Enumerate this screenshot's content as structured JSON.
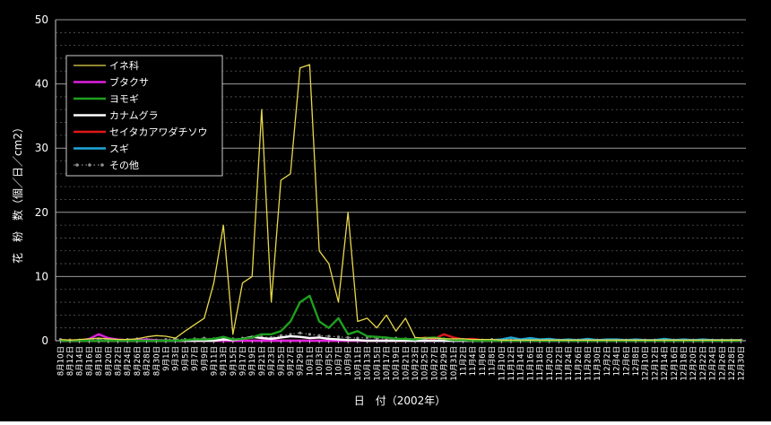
{
  "chart_data": {
    "type": "line",
    "xlabel": "日　付（2002年）",
    "ylabel": "花　粉　数（個／日／cm2）",
    "ylim": [
      0,
      50
    ],
    "yticks": [
      0,
      10,
      20,
      30,
      40,
      50
    ],
    "grid": true,
    "legend_position": "top-left",
    "x": [
      "8月10日",
      "8月12日",
      "8月14日",
      "8月16日",
      "8月18日",
      "8月20日",
      "8月22日",
      "8月24日",
      "8月26日",
      "8月28日",
      "8月30日",
      "9月1日",
      "9月3日",
      "9月5日",
      "9月7日",
      "9月9日",
      "9月11日",
      "9月13日",
      "9月15日",
      "9月17日",
      "9月19日",
      "9月21日",
      "9月23日",
      "9月25日",
      "9月27日",
      "9月29日",
      "10月1日",
      "10月3日",
      "10月5日",
      "10月7日",
      "10月9日",
      "10月11日",
      "10月13日",
      "10月15日",
      "10月17日",
      "10月19日",
      "10月21日",
      "10月23日",
      "10月25日",
      "10月27日",
      "10月29日",
      "10月31日",
      "11月2日",
      "11月4日",
      "11月6日",
      "11月8日",
      "11月10日",
      "11月12日",
      "11月14日",
      "11月16日",
      "11月18日",
      "11月20日",
      "11月22日",
      "11月24日",
      "11月26日",
      "11月28日",
      "11月30日",
      "12月2日",
      "12月4日",
      "12月6日",
      "12月8日",
      "12月10日",
      "12月12日",
      "12月14日",
      "12月16日",
      "12月18日",
      "12月20日",
      "12月22日",
      "12月24日",
      "12月26日",
      "12月28日",
      "12月30日"
    ],
    "series": [
      {
        "name": "イネ科",
        "color": "#e8d84a",
        "style": "solid",
        "values": [
          0.2,
          0.1,
          0.2,
          0.3,
          0.4,
          0.3,
          0.2,
          0.2,
          0.3,
          0.6,
          0.8,
          0.7,
          0.4,
          1.5,
          2.5,
          3.5,
          9,
          18,
          1,
          9,
          10,
          36,
          6,
          25,
          26,
          42.5,
          43,
          14,
          12,
          6,
          20,
          3,
          3.5,
          2,
          4,
          1.5,
          3.5,
          0.5,
          0.4,
          0.4,
          0.3,
          0.3,
          0.3,
          0.2,
          0.2,
          0.2,
          0.1,
          0.1,
          0.1,
          0.1,
          0.1,
          0.1,
          0.1,
          0.1,
          0.1,
          0.1,
          0.1,
          0.1,
          0.1,
          0.1,
          0.1,
          0.1,
          0.1,
          0.1,
          0.1,
          0.1,
          0.1,
          0.1,
          0.1,
          0.1,
          0.1,
          0.1
        ]
      },
      {
        "name": "ブタクサ",
        "color": "#e020e0",
        "style": "solid",
        "values": [
          0,
          0,
          0,
          0.3,
          1,
          0.4,
          0.2,
          0.1,
          0.1,
          0.2,
          0.1,
          0,
          0,
          0,
          0,
          0,
          0,
          0,
          0,
          0,
          0,
          0,
          0,
          0,
          0,
          0,
          0,
          0,
          0,
          0,
          0,
          0,
          0,
          0,
          0,
          0,
          0,
          0,
          0,
          0,
          0,
          0,
          0,
          0,
          0,
          0,
          0,
          0,
          0,
          0,
          0,
          0,
          0,
          0,
          0,
          0,
          0,
          0,
          0,
          0,
          0,
          0,
          0,
          0,
          0,
          0,
          0,
          0,
          0,
          0,
          0,
          0
        ]
      },
      {
        "name": "ヨモギ",
        "color": "#1ea01e",
        "style": "solid",
        "values": [
          0,
          0,
          0,
          0,
          0,
          0,
          0,
          0,
          0,
          0,
          0,
          0,
          0,
          0.1,
          0.2,
          0.2,
          0.3,
          0.6,
          0.2,
          0.3,
          0.5,
          1,
          1,
          1.5,
          3,
          6,
          7,
          3,
          2,
          3.5,
          1,
          1.5,
          0.7,
          0.6,
          0.5,
          0.3,
          0.3,
          0.2,
          0.4,
          0.5,
          0.3,
          0.1,
          0.1,
          0,
          0,
          0,
          0,
          0,
          0,
          0,
          0,
          0,
          0,
          0,
          0,
          0,
          0,
          0,
          0,
          0,
          0,
          0,
          0,
          0,
          0,
          0,
          0,
          0,
          0,
          0,
          0,
          0
        ]
      },
      {
        "name": "カナムグラ",
        "color": "#ffffff",
        "style": "solid",
        "values": [
          0,
          0,
          0,
          0,
          0,
          0,
          0,
          0,
          0,
          0,
          0,
          0,
          0,
          0,
          0,
          0,
          0,
          0.2,
          0.1,
          0.3,
          0.6,
          0.4,
          0.3,
          0.5,
          0.7,
          0.6,
          0.4,
          0.5,
          0.3,
          0.2,
          0.1,
          0.1,
          0,
          0,
          0,
          0,
          0,
          0,
          0,
          0,
          0,
          0,
          0,
          0,
          0,
          0,
          0,
          0,
          0,
          0,
          0,
          0,
          0,
          0,
          0,
          0,
          0,
          0,
          0,
          0,
          0,
          0,
          0,
          0,
          0,
          0,
          0,
          0,
          0,
          0,
          0,
          0
        ]
      },
      {
        "name": "セイタカアワダチソウ",
        "color": "#e01818",
        "style": "solid",
        "values": [
          0,
          0,
          0,
          0,
          0,
          0,
          0,
          0,
          0,
          0,
          0,
          0,
          0,
          0,
          0,
          0,
          0,
          0,
          0,
          0,
          0,
          0,
          0,
          0,
          0,
          0,
          0,
          0,
          0,
          0,
          0,
          0,
          0,
          0,
          0,
          0,
          0,
          0.1,
          0.5,
          0.3,
          1,
          0.5,
          0.2,
          0.3,
          0.1,
          0,
          0,
          0,
          0,
          0,
          0,
          0,
          0,
          0,
          0,
          0,
          0,
          0,
          0,
          0,
          0,
          0,
          0,
          0,
          0,
          0,
          0,
          0,
          0,
          0,
          0,
          0
        ]
      },
      {
        "name": "スギ",
        "color": "#1ea8d8",
        "style": "solid",
        "values": [
          0,
          0,
          0,
          0,
          0,
          0,
          0,
          0,
          0,
          0,
          0,
          0,
          0,
          0,
          0,
          0,
          0,
          0,
          0,
          0,
          0,
          0,
          0,
          0,
          0,
          0,
          0,
          0,
          0,
          0,
          0,
          0,
          0,
          0,
          0,
          0,
          0,
          0,
          0,
          0,
          0,
          0,
          0,
          0,
          0,
          0.1,
          0.2,
          0.5,
          0.2,
          0.4,
          0.2,
          0.3,
          0.1,
          0.2,
          0.1,
          0.3,
          0.1,
          0.2,
          0.2,
          0.1,
          0.2,
          0.1,
          0.1,
          0.3,
          0.1,
          0.2,
          0.1,
          0.2,
          0.1,
          0.1,
          0.1,
          0.1
        ]
      },
      {
        "name": "その他",
        "color": "#909090",
        "style": "dotted",
        "values": [
          0.2,
          0.1,
          0.1,
          0.2,
          0.3,
          0.2,
          0.1,
          0.2,
          0.3,
          0.2,
          0.1,
          0.2,
          0.3,
          0.2,
          0.3,
          0.4,
          0.3,
          0.5,
          0.3,
          0.4,
          0.5,
          0.6,
          0.5,
          0.8,
          1,
          1.2,
          1,
          0.8,
          0.7,
          0.6,
          0.5,
          0.4,
          0.5,
          0.4,
          0.3,
          0.4,
          0.3,
          0.3,
          0.3,
          0.2,
          0.3,
          0.2,
          0.2,
          0.1,
          0.1,
          0.2,
          0.1,
          0.1,
          0.1,
          0.1,
          0.1,
          0.1,
          0.1,
          0.1,
          0.1,
          0.1,
          0.1,
          0.1,
          0.1,
          0.1,
          0.1,
          0.1,
          0.1,
          0.1,
          0.1,
          0.1,
          0.1,
          0.1,
          0.1,
          0.1,
          0.1,
          0.1
        ]
      }
    ]
  }
}
